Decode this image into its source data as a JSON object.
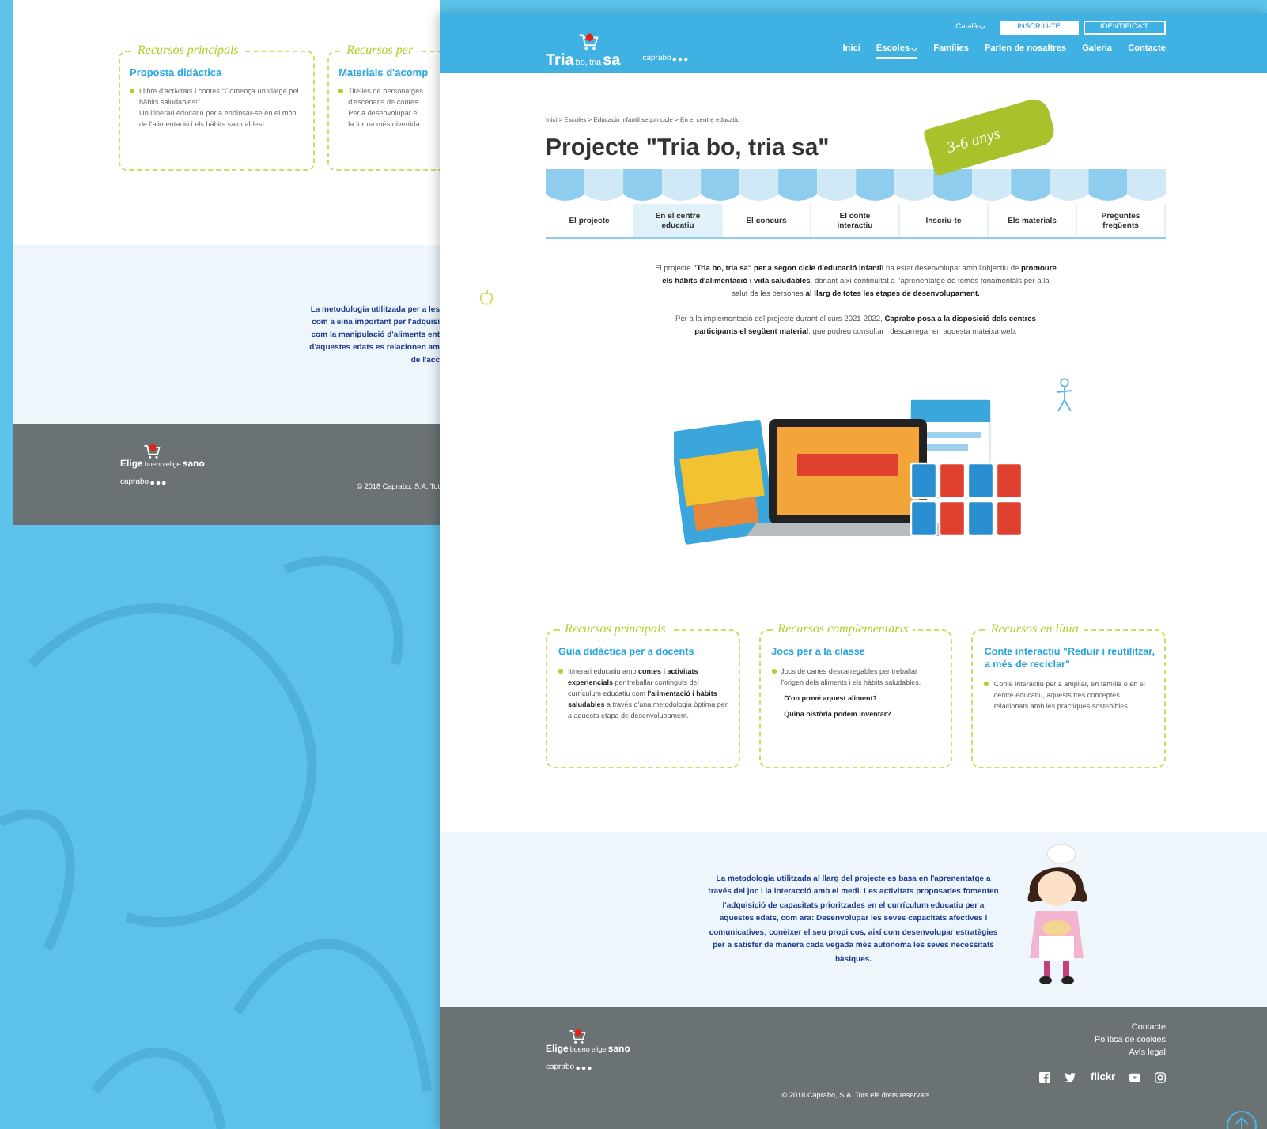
{
  "back_page": {
    "resources": [
      {
        "heading": "Recursos principals",
        "title": "Proposta didàctica",
        "lines": [
          "Llibre d'activitats i contes \"Comença un viatge pel hàbits saludables!\"",
          "Un itinerari educatiu per a endinsar-se en el món de l'alimentació i els hàbits saludables!"
        ]
      },
      {
        "heading": "Recursos per",
        "title": "Materials d'acomp",
        "lines": [
          "Titelles de personatges",
          "d'escenaris de contes.",
          "Per a desenvolupar el",
          "la forma més divertida"
        ]
      }
    ],
    "methodology_lines": [
      "La metodologia utilitzada per a les",
      "com a eina important per l'adquisi",
      "com la manipulació d'aliments ent",
      "d'aquestes edats es relacionen am",
      "de l'acc"
    ],
    "footer": {
      "logo_words": [
        {
          "text": "Elige",
          "kind": "large"
        },
        {
          "text": "bueno",
          "kind": "small"
        },
        {
          "text": "elige",
          "kind": "small"
        },
        {
          "text": "sano",
          "kind": "large"
        }
      ],
      "brand": "caprabo",
      "copyright": "© 2018 Caprabo, S.A. Tot"
    }
  },
  "front_page": {
    "header": {
      "logo_words": [
        {
          "text": "Tria",
          "kind": "large"
        },
        {
          "text": "bo,",
          "kind": "small"
        },
        {
          "text": "tria",
          "kind": "small"
        },
        {
          "text": "sa",
          "kind": "large"
        }
      ],
      "brand": "caprabo",
      "language": "Català",
      "buttons": [
        {
          "label": "INSCRIU-TE",
          "kind": "filled"
        },
        {
          "label": "IDENTIFICA'T",
          "kind": "outline"
        }
      ],
      "nav": [
        {
          "label": "Inici",
          "selected": false,
          "dropdown": false
        },
        {
          "label": "Escoles",
          "selected": true,
          "dropdown": true
        },
        {
          "label": "Famílies",
          "selected": false,
          "dropdown": false
        },
        {
          "label": "Parlen de nosaltres",
          "selected": false,
          "dropdown": false
        },
        {
          "label": "Galeria",
          "selected": false,
          "dropdown": false
        },
        {
          "label": "Contacte",
          "selected": false,
          "dropdown": false
        }
      ]
    },
    "breadcrumb": "Inici > Escoles > Educació infantil segon cicle > En el centre educatiu",
    "title": "Projecte \"Tria bo, tria sa\"",
    "age_tag": "3-6 anys",
    "tabs": [
      {
        "label": "El projecte",
        "selected": false
      },
      {
        "label": "En el centre educatiu",
        "selected": true
      },
      {
        "label": "El concurs",
        "selected": false
      },
      {
        "label": "El conte interactiu",
        "selected": false
      },
      {
        "label": "Inscriu-te",
        "selected": false
      },
      {
        "label": "Els materials",
        "selected": false
      },
      {
        "label": "Preguntes freqüents",
        "selected": false
      }
    ],
    "intro": [
      "El projecte **\"Tria bo, tria sa\" per a segon cicle d'educació infantil** ha estat desenvolupat amb l'objectiu de **promoure els hàbits d'alimentació i vida saludables**, donant així continuïtat a l'aprenentatge de temes fonamentals per a la salut de les persones **al llarg de totes les etapes de desenvolupament.**",
      "Per a la implementació del projecte durant el curs 2021-2022, **Caprabo posa a la disposició dels centres participants el següent material**, que podreu consultar i descarregar en aquesta mateixa web:"
    ],
    "resources": [
      {
        "heading": "Recursos principals",
        "title": "Guia didàctica per a docents",
        "bullet": "Itinerari educatiu amb **contes i activitats experiencials** per treballar continguts del currículum educatiu com **l'alimentació i hàbits saludables** a través d'una metodologia òptima per a aquesta etapa de desenvolupament."
      },
      {
        "heading": "Recursos complementaris",
        "title": "Jocs per a la classe",
        "bullet": "Jocs de cartes descarregables per treballar l'origen dels aliments i els hàbits saludables.",
        "extra": [
          "D'on prové aquest aliment?",
          "Quina història podem inventar?"
        ]
      },
      {
        "heading": "Recursos en línia",
        "title": "Conte interactiu \"Reduir i reutilitzar, a més de reciclar\"",
        "bullet": "Conte interactiu per a ampliar, en família o en el centre educatiu, aquests tres conceptes relacionats amb les pràctiques sostenibles."
      }
    ],
    "methodology": "La metodologia utilitzada al llarg del projecte es basa en l'aprenentatge a través del joc i la interacció amb el medi. Les activitats proposades fomenten l'adquisició de capacitats prioritzades en el currículum educatiu per a aquestes edats, com ara: Desenvolupar les seves capacitats afectives i comunicatives; conèixer el seu propi cos, així com desenvolupar estratègies per a satisfer de manera cada vegada més autònoma les seves necessitats bàsiques.",
    "footer": {
      "logo_words": [
        {
          "text": "Elige",
          "kind": "large"
        },
        {
          "text": "bueno",
          "kind": "small"
        },
        {
          "text": "elige",
          "kind": "small"
        },
        {
          "text": "sano",
          "kind": "large"
        }
      ],
      "brand": "caprabo",
      "links": [
        "Contacte",
        "Política de cookies",
        "Avís legal"
      ],
      "flickr_label": "flickr",
      "copyright": "© 2018 Caprabo, S.A. Tots els drets reservats"
    }
  }
}
